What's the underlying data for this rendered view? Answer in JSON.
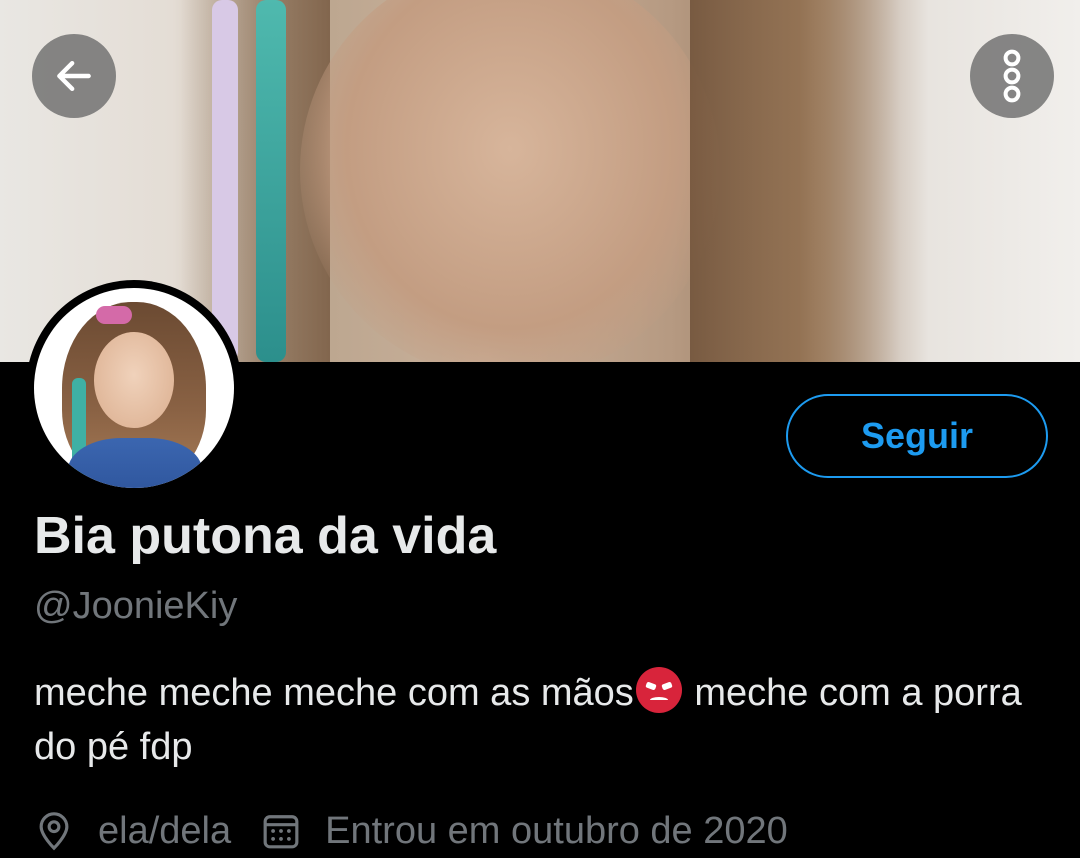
{
  "header": {
    "back_icon": "arrow-left-icon",
    "more_icon": "more-vertical-icon"
  },
  "profile": {
    "display_name": "Bia putona da vida",
    "handle": "@JoonieKiy",
    "bio_part1": "meche meche meche com as mãos",
    "bio_emoji": "angry-face-emoji",
    "bio_part2": " meche com a porra do pé fdp",
    "pronouns": "ela/dela",
    "joined": "Entrou em outubro de 2020"
  },
  "actions": {
    "follow_label": "Seguir"
  },
  "colors": {
    "accent": "#1d9bf0",
    "background": "#000000",
    "primary_text": "#e7e9ea",
    "secondary_text": "#71767b"
  }
}
